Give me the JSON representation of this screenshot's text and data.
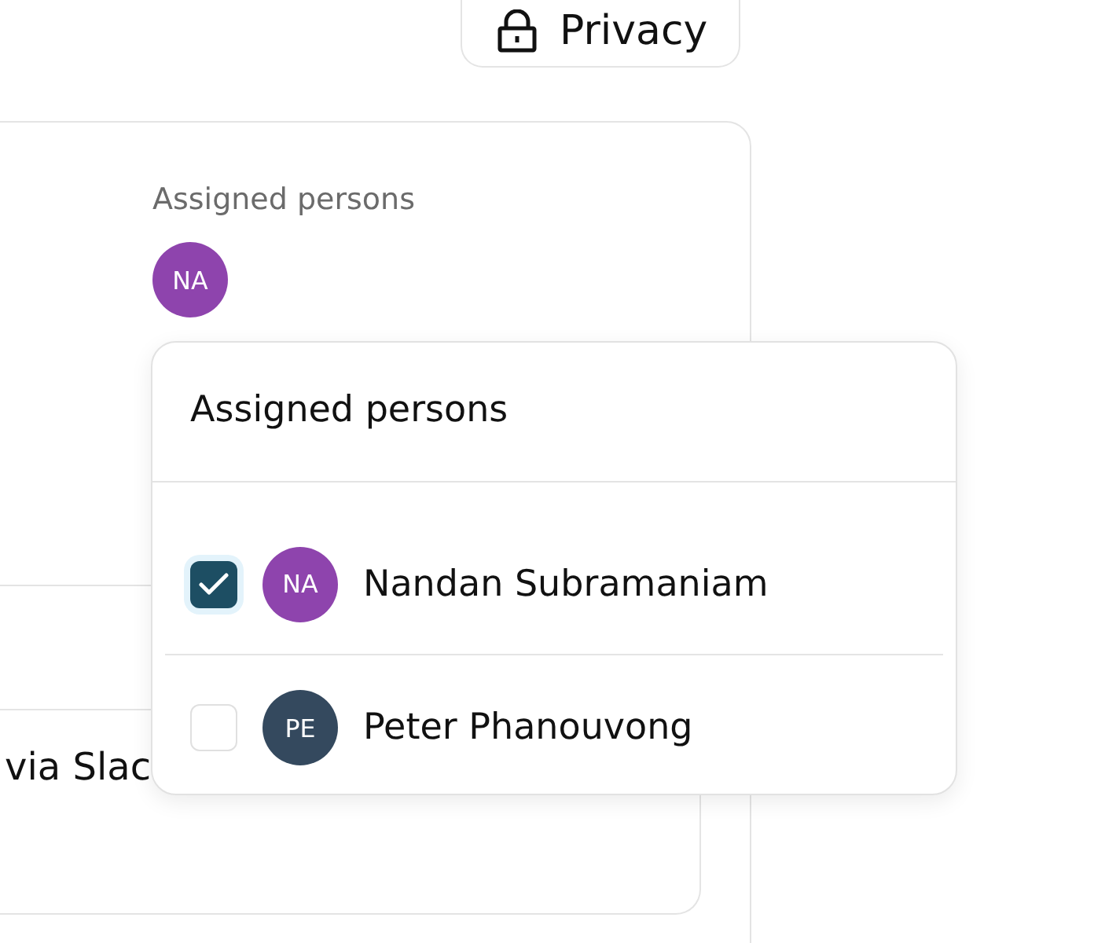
{
  "privacy_button": {
    "label": "Privacy"
  },
  "card": {
    "label": "Assigned persons",
    "assigned": [
      {
        "initials": "NA",
        "color": "#8e44ad"
      }
    ],
    "inner_text": "via Slac"
  },
  "popover": {
    "title": "Assigned persons",
    "people": [
      {
        "name": "Nandan Subramaniam",
        "initials": "NA",
        "color": "#8e44ad",
        "checked": true
      },
      {
        "name": "Peter Phanouvong",
        "initials": "PE",
        "color": "#34495e",
        "checked": false
      }
    ]
  }
}
